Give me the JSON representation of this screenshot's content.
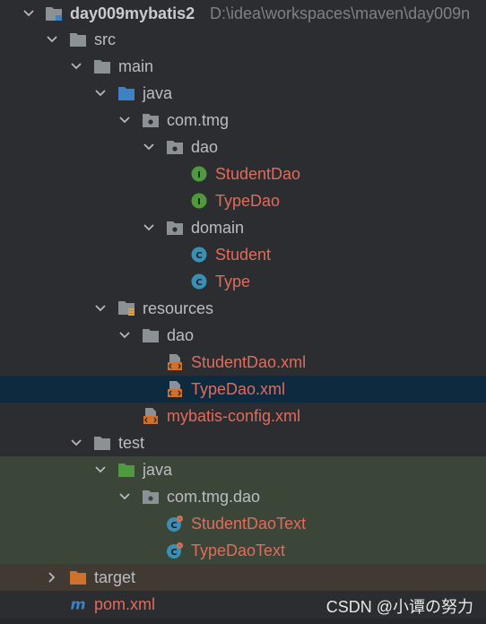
{
  "project": {
    "name": "day009mybatis2",
    "path": "D:\\idea\\workspaces\\maven\\day009n"
  },
  "nodes": {
    "src": "src",
    "main": "main",
    "java_main": "java",
    "pkg_main": "com.tmg",
    "dao_pkg": "dao",
    "student_dao": "StudentDao",
    "type_dao": "TypeDao",
    "domain_pkg": "domain",
    "student": "Student",
    "type": "Type",
    "resources": "resources",
    "dao_res": "dao",
    "student_dao_xml": "StudentDao.xml",
    "type_dao_xml": "TypeDao.xml",
    "mybatis_config": "mybatis-config.xml",
    "test": "test",
    "java_test": "java",
    "pkg_test": "com.tmg.dao",
    "student_dao_text": "StudentDaoText",
    "type_dao_text": "TypeDaoText",
    "target": "target",
    "pom": "pom.xml"
  },
  "icon_letters": {
    "interface": "I",
    "class": "C",
    "maven": "m"
  },
  "watermark": "CSDN @小谭の努力",
  "colors": {
    "background": "#2b2d30",
    "text": "#bbbdc2",
    "modified_text": "#e06c5c",
    "selected_row": "#0e2a3f",
    "test_band": "#3b4639",
    "target_band": "#403a33",
    "folder": "#8c9196",
    "java_source_folder": "#3d82c4",
    "java_test_folder": "#4f9a3e",
    "target_folder": "#d0702a",
    "interface_badge": "#4f9a3e",
    "class_badge": "#3a8fb5"
  }
}
